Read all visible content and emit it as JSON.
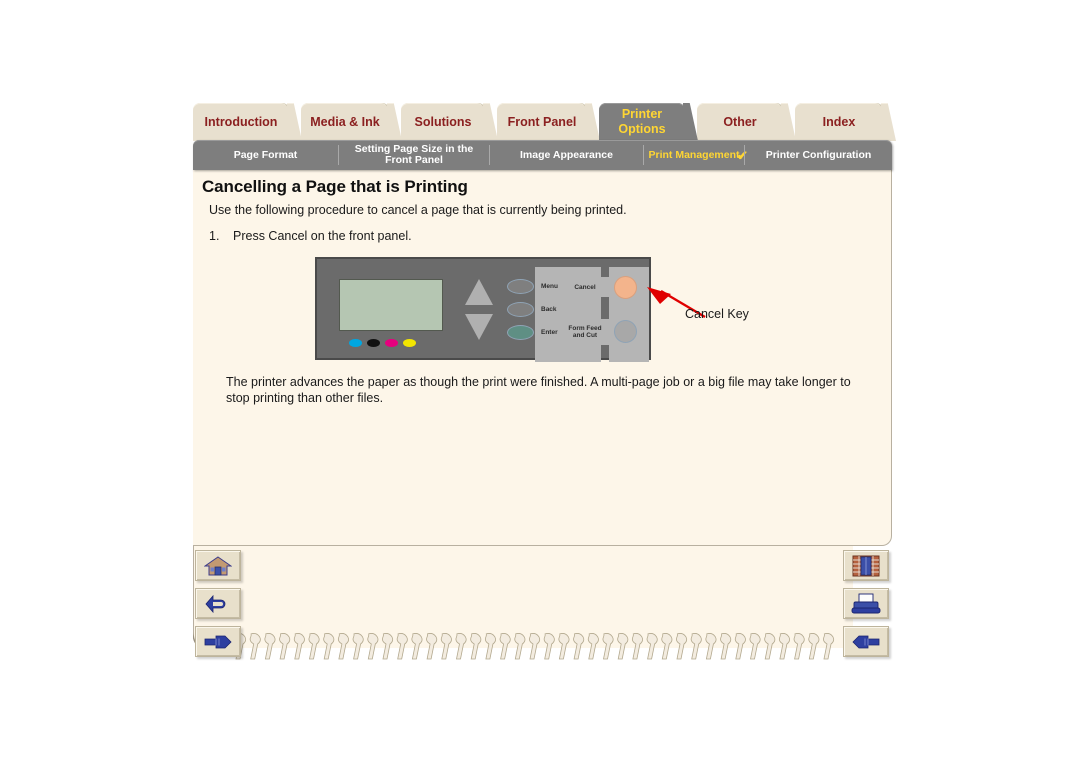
{
  "document": {
    "title": "Cancelling a Page that is Printing",
    "intro": "Use the following procedure to cancel a page that is currently being printed.",
    "step_number": "1.",
    "step_text": "Press Cancel on the front panel.",
    "outro": "The printer advances the paper as though the print were finished. A multi-page job or a big file may take longer to stop printing than other files."
  },
  "main_tabs": [
    {
      "label": "Introduction",
      "active": false
    },
    {
      "label": "Media & Ink",
      "active": false
    },
    {
      "label": "Solutions",
      "active": false
    },
    {
      "label": "Front Panel",
      "active": false
    },
    {
      "label": "Printer Options",
      "label_line1": "Printer",
      "label_line2": "Options",
      "active": true
    },
    {
      "label": "Other",
      "active": false
    },
    {
      "label": "Index",
      "active": false
    }
  ],
  "sub_tabs": [
    {
      "label": "Page Format",
      "active": false,
      "check": ""
    },
    {
      "label_line1": "Setting Page Size in the",
      "label_line2": "Front Panel",
      "label": "Setting Page Size in the Front Panel",
      "active": false,
      "check": ""
    },
    {
      "label": "Image Appearance",
      "active": false,
      "check": ""
    },
    {
      "label": "Print Management",
      "active": true,
      "check": "✔"
    },
    {
      "label": "Printer Configuration",
      "active": false,
      "check": ""
    }
  ],
  "illustration": {
    "callout_label": "Cancel Key",
    "panel_name": "printer-front-panel",
    "lcd_color": "#b5c6b2",
    "ink_dots": [
      {
        "name": "cyan",
        "color": "#00a7e1"
      },
      {
        "name": "black",
        "color": "#111111"
      },
      {
        "name": "magenta",
        "color": "#e6007e"
      },
      {
        "name": "yellow",
        "color": "#f2e500"
      }
    ],
    "buttons": [
      {
        "name": "menu",
        "label": "Menu",
        "key_color": "#7f7f7f"
      },
      {
        "name": "back",
        "label": "Back",
        "key_color": "#7f7f7f"
      },
      {
        "name": "enter",
        "label": "Enter",
        "key_color": "#5f8f84"
      }
    ],
    "right_buttons": [
      {
        "name": "cancel",
        "label": "Cancel",
        "key_color": "#f3b48c"
      },
      {
        "name": "form-feed-and-cut",
        "label_line1": "Form Feed",
        "label_line2": "and Cut",
        "label": "Form Feed and Cut",
        "key_color": "#a8a8a8"
      }
    ],
    "arrow_color": "#e00000"
  },
  "nav_buttons_left": [
    {
      "name": "home",
      "icon": "house-icon"
    },
    {
      "name": "back",
      "icon": "back-arrow-icon"
    },
    {
      "name": "forward",
      "icon": "hand-pointing-right-icon"
    }
  ],
  "nav_buttons_right": [
    {
      "name": "index",
      "icon": "bookshelf-icon"
    },
    {
      "name": "print",
      "icon": "printer-icon"
    },
    {
      "name": "previous",
      "icon": "hand-pointing-left-icon"
    }
  ],
  "colors": {
    "tab_inactive_bg": "#e8e0cf",
    "tab_inactive_text": "#8b2020",
    "tab_active_bg": "#7e7e7e",
    "tab_active_text": "#ffd633",
    "page_bg": "#fdf6e9",
    "subnav_bg": "#7e7e7e"
  }
}
